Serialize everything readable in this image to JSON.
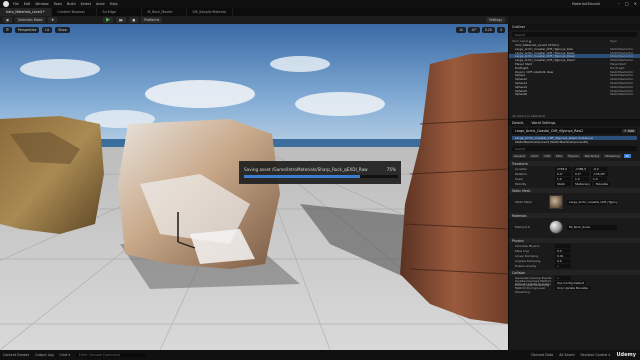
{
  "menubar": {
    "menus": [
      "File",
      "Edit",
      "Window",
      "Tools",
      "Build",
      "Select",
      "Actor",
      "Help"
    ],
    "project": "MaterialsTutorial",
    "window_controls": [
      "–",
      "□",
      "✕"
    ]
  },
  "tabs": [
    {
      "label": "Intro_Materials_Level1*",
      "active": true
    },
    {
      "label": "Content Browser",
      "active": false
    },
    {
      "label": "Sn·Edge",
      "active": false
    },
    {
      "label": "M_Rock_Master",
      "active": false
    },
    {
      "label": "SM_Sample·Material",
      "active": false
    }
  ],
  "toolbar": {
    "selection_mode": "Selection Mode",
    "platforms": "Platforms",
    "settings": "Settings"
  },
  "viewport": {
    "perspective": "Perspective",
    "lit": "Lit",
    "show": "Show",
    "right_controls": [
      "10",
      "10°",
      "0.25",
      "4"
    ]
  },
  "saving_dialog": {
    "message": "Saving asset /Game/IntroMaterials/Sharp_Rock_qEXDI_Raw",
    "percent_label": "75%",
    "progress": 0.75
  },
  "outliner": {
    "title": "Outliner",
    "search_placeholder": "Search",
    "columns": [
      "Item Label ▲",
      "Type"
    ],
    "rows": [
      {
        "name": "Intro_Materials_Level1 (Editor)",
        "type": "",
        "selected": false
      },
      {
        "name": "Large_Arctic_Coastal_Cliff_rfJgvnya_Raw",
        "type": "StaticMeshActor",
        "selected": false
      },
      {
        "name": "Large_Arctic_Coastal_Cliff_rfJgvnya_Raw1",
        "type": "StaticMeshActor",
        "selected": false
      },
      {
        "name": "Large_Arctic_Coastal_Cliff_rfJgvnya_Raw2",
        "type": "StaticMeshActor",
        "selected": true
      },
      {
        "name": "Large_Arctic_Coastal_Cliff_rfJgvnya_Raw3",
        "type": "StaticMeshActor",
        "selected": false
      },
      {
        "name": "Player Start",
        "type": "PlayerStart",
        "selected": false
      },
      {
        "name": "PostLight",
        "type": "PointLight",
        "selected": false
      },
      {
        "name": "Quarry_Cliff_sdsdbdb_Raw",
        "type": "StaticMeshActor",
        "selected": false
      },
      {
        "name": "Sphere",
        "type": "StaticMeshActor",
        "selected": false
      },
      {
        "name": "Sphere2",
        "type": "StaticMeshActor",
        "selected": false
      },
      {
        "name": "Sphere3",
        "type": "StaticMeshActor",
        "selected": false
      },
      {
        "name": "Sphere4",
        "type": "StaticMeshActor",
        "selected": false
      },
      {
        "name": "Sphere5",
        "type": "StaticMeshActor",
        "selected": false
      },
      {
        "name": "Sphere6",
        "type": "StaticMeshActor",
        "selected": false
      }
    ],
    "footer": "16 actors (1 selected)"
  },
  "details": {
    "tabs": [
      "Details",
      "World Settings"
    ],
    "actor_name": "Large_Arctic_Coastal_Cliff_rfJgvnya_Raw2",
    "add_label": "+ Add",
    "components": [
      {
        "label": "Large_Arctic_Coastal_Cliff_rfJgvnya_Raw2 (Instance)",
        "selected": true
      },
      {
        "label": "StaticMeshComponent (StaticMeshComponent0)",
        "selected": false
      }
    ],
    "search_placeholder": "Search",
    "filters": [
      {
        "label": "General",
        "on": false
      },
      {
        "label": "Actor",
        "on": false
      },
      {
        "label": "LOD",
        "on": false
      },
      {
        "label": "Misc",
        "on": false
      },
      {
        "label": "Physics",
        "on": false
      },
      {
        "label": "Rendering",
        "on": false
      },
      {
        "label": "Streaming",
        "on": false
      },
      {
        "label": "All",
        "on": true
      }
    ],
    "transform_section": "Transform",
    "transform": [
      {
        "key": "Location",
        "values": [
          "2748.0",
          "-1386.0",
          "-0.0"
        ]
      },
      {
        "key": "Rotation",
        "values": [
          "0.0°",
          "0.0°",
          "-135.06°"
        ]
      },
      {
        "key": "Scale",
        "values": [
          "1.0",
          "1.0",
          "1.0"
        ]
      },
      {
        "key": "Mobility",
        "values": [
          "Static",
          "Stationary",
          "Movable"
        ]
      }
    ],
    "static_mesh_section": "Static Mesh",
    "static_mesh_label": "Static Mesh",
    "static_mesh_value": "Large_Arctic_Coastal_Cliff_rfJgvnya",
    "materials_section": "Materials",
    "element_label": "Element 0",
    "material_value": "MI_Rock_Snow",
    "physics_section": "Physics",
    "physics": [
      {
        "key": "Simulate Physics",
        "values": [
          ""
        ]
      },
      {
        "key": "Mass (kg)",
        "values": [
          "0.0"
        ]
      },
      {
        "key": "Linear Damping",
        "values": [
          "0.01"
        ]
      },
      {
        "key": "Angular Damping",
        "values": [
          "0.0"
        ]
      },
      {
        "key": "Enable Gravity",
        "values": [
          "✓"
        ]
      }
    ],
    "collision_section": "Collision",
    "collision": [
      {
        "key": "Generate Overlap Events",
        "values": [
          "✓"
        ]
      },
      {
        "key": "Update Overlaps Method During Level Streaming",
        "values": [
          "Use Config Default"
        ]
      },
      {
        "key": "Default Update Overlaps Method During Level Streaming",
        "values": [
          "Only Update Movable"
        ]
      }
    ]
  },
  "statusbar": {
    "left": [
      "Content Drawer",
      "Output Log",
      "Cmd ▾"
    ],
    "console_placeholder": "Enter Console Command",
    "right": [
      "Derived Data",
      "All Saved",
      "Revision Control ▾"
    ],
    "brand": "Udemy"
  },
  "colors": {
    "accent": "#3a7fcf",
    "selection": "#2b4f78",
    "play": "#4fbf4f"
  }
}
